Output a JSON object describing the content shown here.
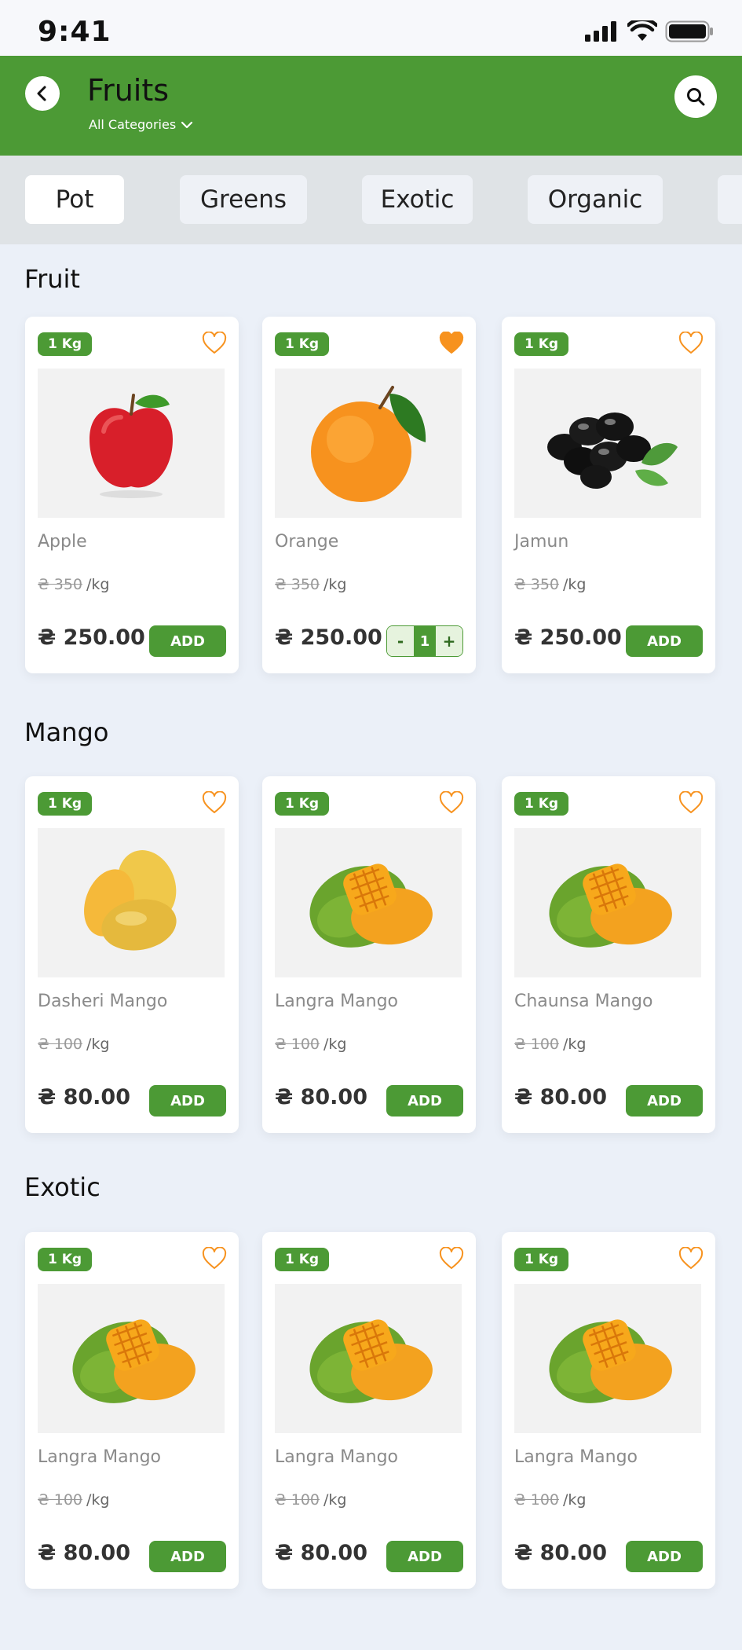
{
  "status_bar": {
    "time": "9:41"
  },
  "header": {
    "title": "Fruits",
    "subtitle": "All Categories"
  },
  "tabs": [
    {
      "label": "Pot",
      "active": true
    },
    {
      "label": "Greens",
      "active": false
    },
    {
      "label": "Exotic",
      "active": false
    },
    {
      "label": "Organic",
      "active": false
    }
  ],
  "colors": {
    "brand_green": "#4c9a35",
    "favorite_orange": "#f7921e",
    "background": "#ebf0f8"
  },
  "sections": [
    {
      "title": "Fruit",
      "products": [
        {
          "badge": "1 Kg",
          "name": "Apple",
          "old_price": "₴ 350",
          "unit": "/kg",
          "price": "₴ 250.00",
          "action": "ADD",
          "favorite": false,
          "image": "apple"
        },
        {
          "badge": "1 Kg",
          "name": "Orange",
          "old_price": "₴ 350",
          "unit": "/kg",
          "price": "₴ 250.00",
          "action": "stepper",
          "qty": "1",
          "minus": "-",
          "plus": "+",
          "favorite": true,
          "image": "orange"
        },
        {
          "badge": "1 Kg",
          "name": "Jamun",
          "old_price": "₴ 350",
          "unit": "/kg",
          "price": "₴ 250.00",
          "action": "ADD",
          "favorite": false,
          "image": "jamun"
        }
      ]
    },
    {
      "title": "Mango",
      "products": [
        {
          "badge": "1 Kg",
          "name": "Dasheri Mango",
          "old_price": "₴ 100",
          "unit": "/kg",
          "price": "₴ 80.00",
          "action": "ADD",
          "favorite": false,
          "image": "dasheri-mango"
        },
        {
          "badge": "1 Kg",
          "name": "Langra Mango",
          "old_price": "₴ 100",
          "unit": "/kg",
          "price": "₴ 80.00",
          "action": "ADD",
          "favorite": false,
          "image": "cut-mango"
        },
        {
          "badge": "1 Kg",
          "name": "Chaunsa Mango",
          "old_price": "₴ 100",
          "unit": "/kg",
          "price": "₴ 80.00",
          "action": "ADD",
          "favorite": false,
          "image": "cut-mango"
        }
      ]
    },
    {
      "title": "Exotic",
      "products": [
        {
          "badge": "1 Kg",
          "name": "Langra Mango",
          "old_price": "₴ 100",
          "unit": "/kg",
          "price": "₴ 80.00",
          "action": "ADD",
          "favorite": false,
          "image": "cut-mango"
        },
        {
          "badge": "1 Kg",
          "name": "Langra Mango",
          "old_price": "₴ 100",
          "unit": "/kg",
          "price": "₴ 80.00",
          "action": "ADD",
          "favorite": false,
          "image": "cut-mango"
        },
        {
          "badge": "1 Kg",
          "name": "Langra Mango",
          "old_price": "₴ 100",
          "unit": "/kg",
          "price": "₴ 80.00",
          "action": "ADD",
          "favorite": false,
          "image": "cut-mango"
        }
      ]
    }
  ]
}
